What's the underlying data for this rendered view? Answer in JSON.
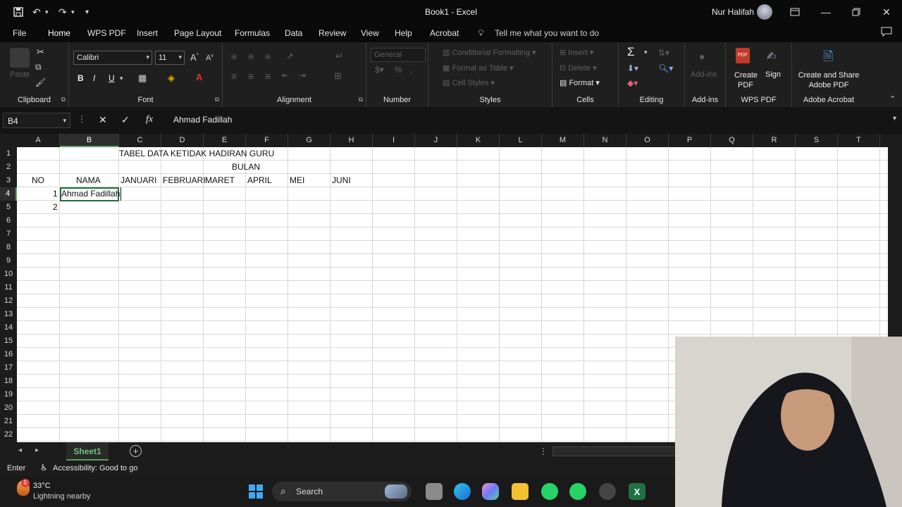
{
  "titlebar": {
    "doc_title": "Book1 - Excel",
    "user_name": "Nur Halifah"
  },
  "menu": {
    "tabs": [
      "File",
      "Home",
      "WPS PDF",
      "Insert",
      "Page Layout",
      "Formulas",
      "Data",
      "Review",
      "View",
      "Help",
      "Acrobat"
    ],
    "active_tab": "Home",
    "tell_me": "Tell me what you want to do"
  },
  "ribbon": {
    "clipboard": {
      "label": "Clipboard",
      "paste": "Paste"
    },
    "font": {
      "label": "Font",
      "name": "Calibri",
      "size": "11",
      "bold": "B",
      "italic": "I",
      "underline": "U"
    },
    "alignment": {
      "label": "Alignment"
    },
    "number": {
      "label": "Number",
      "format": "General"
    },
    "styles": {
      "label": "Styles",
      "conditional": "Conditional Formatting",
      "format_table": "Format as Table",
      "cell_styles": "Cell Styles"
    },
    "cells": {
      "label": "Cells",
      "insert": "Insert",
      "delete": "Delete",
      "format": "Format"
    },
    "editing": {
      "label": "Editing"
    },
    "addins": {
      "label": "Add-ins",
      "button": "Add-ins"
    },
    "wps": {
      "label": "WPS PDF",
      "create": "Create PDF",
      "sign": "Sign"
    },
    "acrobat": {
      "label": "Adobe Acrobat",
      "create_share": "Create and Share Adobe PDF"
    }
  },
  "formula_bar": {
    "name_box": "B4",
    "value": "Ahmad Fadillah"
  },
  "grid": {
    "columns": [
      "A",
      "B",
      "C",
      "D",
      "E",
      "F",
      "G",
      "H",
      "I",
      "J",
      "K",
      "L",
      "M",
      "N",
      "O",
      "P",
      "Q",
      "R",
      "S",
      "T"
    ],
    "rows": [
      "1",
      "2",
      "3",
      "4",
      "5",
      "6",
      "7",
      "8",
      "9",
      "10",
      "11",
      "12",
      "13",
      "14",
      "15",
      "16",
      "17",
      "18",
      "19",
      "20",
      "21",
      "22"
    ],
    "cells": {
      "title": "TABEL DATA KETIDAK HADIRAN GURU",
      "bulan": "BULAN",
      "no": "NO",
      "nama": "NAMA",
      "months": [
        "JANUARI",
        "FEBRUARI",
        "MARET",
        "APRIL",
        "MEI",
        "JUNI"
      ],
      "row4_no": "1",
      "row4_name": "Ahmad Fadillah",
      "row5_no": "2"
    }
  },
  "sheets": {
    "active": "Sheet1"
  },
  "status": {
    "mode": "Enter",
    "accessibility": "Accessibility: Good to go"
  },
  "taskbar": {
    "temp": "33°C",
    "weather": "Lightning nearby",
    "weather_badge": "5",
    "search": "Search"
  }
}
